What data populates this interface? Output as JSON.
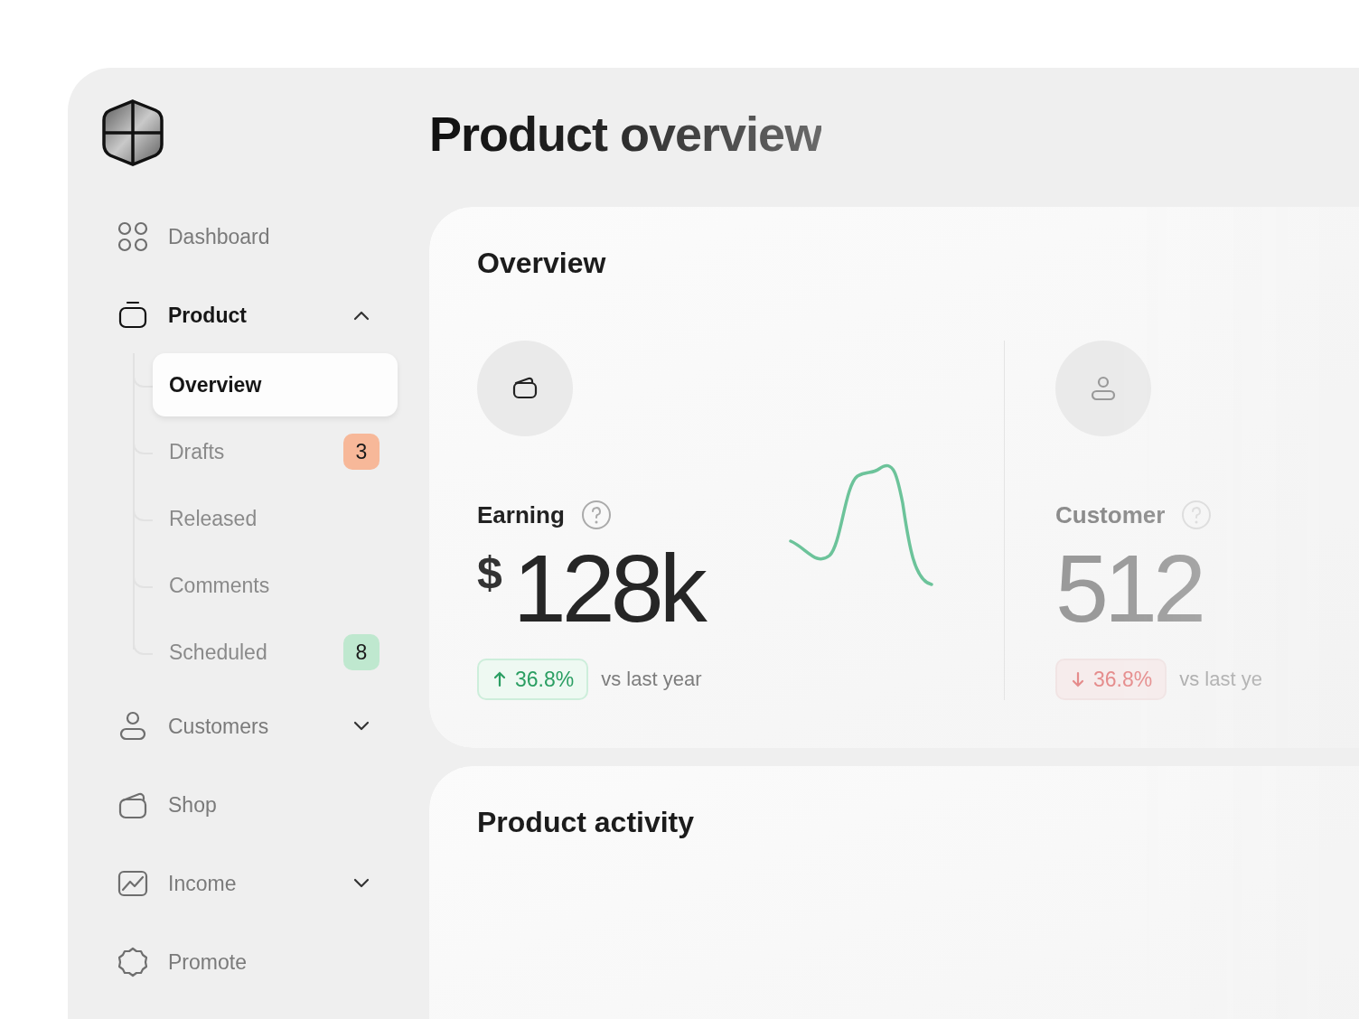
{
  "page_title": "Product overview",
  "sidebar": {
    "items": [
      {
        "label": "Dashboard",
        "selected": false
      },
      {
        "label": "Product",
        "selected": true,
        "expanded": true,
        "children": [
          {
            "label": "Overview",
            "selected": true
          },
          {
            "label": "Drafts",
            "selected": false,
            "badge": "3",
            "color": "#f7b899"
          },
          {
            "label": "Released",
            "selected": false
          },
          {
            "label": "Comments",
            "selected": false
          },
          {
            "label": "Scheduled",
            "selected": false,
            "badge": "8",
            "color": "#bfe8cf"
          }
        ]
      },
      {
        "label": "Customers",
        "selected": false,
        "expanded": false
      },
      {
        "label": "Shop",
        "selected": false
      },
      {
        "label": "Income",
        "selected": false,
        "expanded": false
      },
      {
        "label": "Promote",
        "selected": false
      }
    ]
  },
  "overview_card": {
    "title": "Overview",
    "metrics": [
      {
        "label": "Earning",
        "currency": "$",
        "value": "128k",
        "trend": {
          "positive": true,
          "change": "36.8%"
        },
        "comparison": "vs last year"
      },
      {
        "label": "Customer",
        "value": "512",
        "trend": {
          "positive": false,
          "change": "36.8%"
        },
        "comparison": "vs last ye"
      }
    ]
  },
  "activity_card": {
    "title": "Product activity"
  }
}
